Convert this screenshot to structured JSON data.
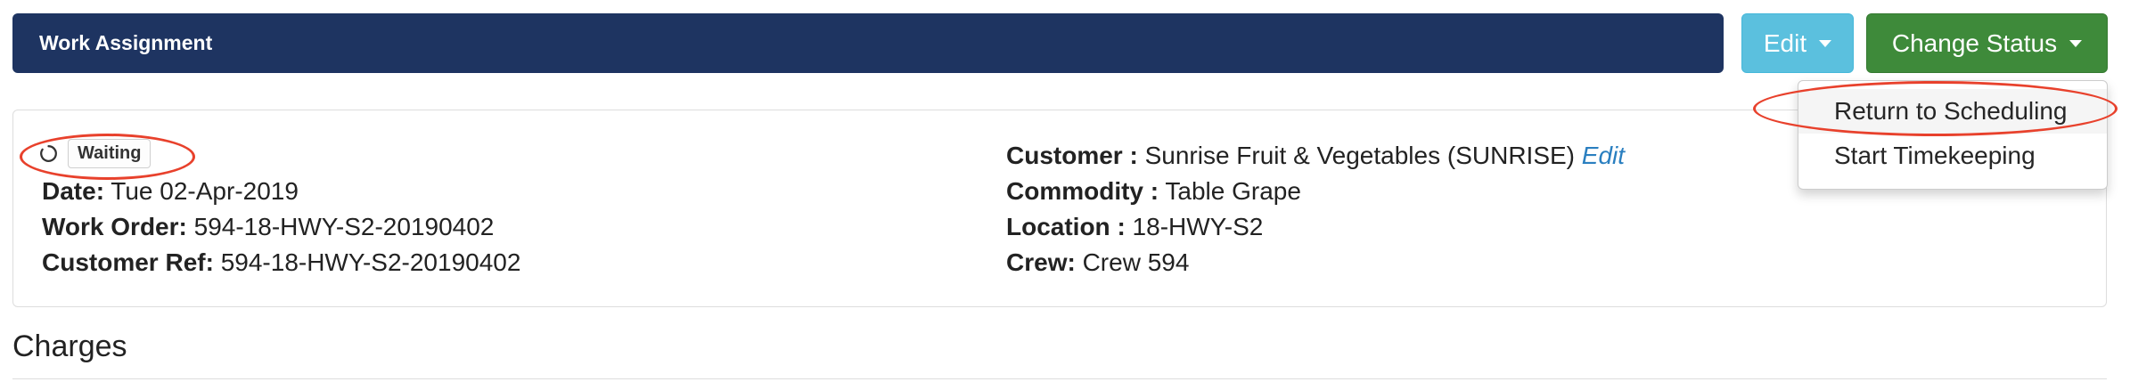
{
  "header": {
    "title": "Work Assignment"
  },
  "toolbar": {
    "edit_label": "Edit",
    "change_status_label": "Change Status"
  },
  "status_menu": {
    "items": [
      {
        "label": "Return to Scheduling"
      },
      {
        "label": "Start Timekeeping"
      }
    ]
  },
  "assignment": {
    "status": "Waiting",
    "date_label": "Date:",
    "date_value": "Tue 02-Apr-2019",
    "work_order_label": "Work Order:",
    "work_order_value": "594-18-HWY-S2-20190402",
    "customer_ref_label": "Customer Ref:",
    "customer_ref_value": "594-18-HWY-S2-20190402",
    "customer_label": "Customer :",
    "customer_value": "Sunrise Fruit & Vegetables (SUNRISE)",
    "customer_edit_link": "Edit",
    "commodity_label": "Commodity :",
    "commodity_value": "Table Grape",
    "location_label": "Location :",
    "location_value": "18-HWY-S2",
    "crew_label": "Crew:",
    "crew_value": "Crew 594"
  },
  "charges": {
    "title": "Charges"
  },
  "icons": {
    "status": "spinner-icon",
    "dropdown": "caret-down-icon"
  },
  "colors": {
    "header_bg": "#1e3461",
    "edit_button": "#5bc0de",
    "change_status_button": "#3e8a3a",
    "annotation": "#e8412c",
    "link": "#2a7fc0"
  }
}
